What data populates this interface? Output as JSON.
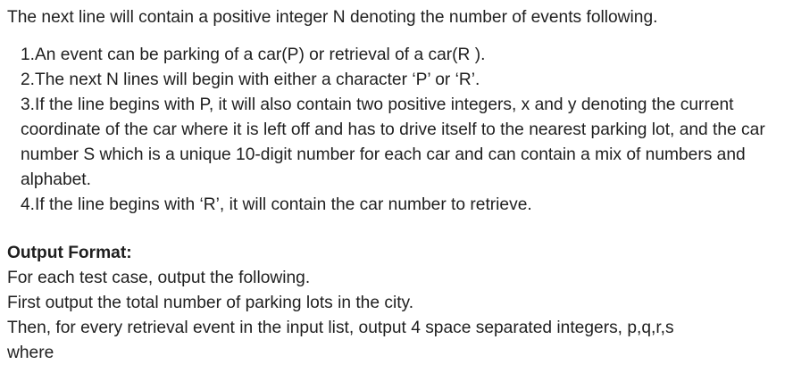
{
  "intro": "The next line will contain a positive integer N denoting the number of events following.",
  "rules": [
    "1.An event can be parking of a car(P) or retrieval of a car(R ).",
    "2.The next N lines will begin with either a character ‘P’ or ‘R’.",
    "3.If the line begins with P, it will also contain two positive integers, x and y denoting the current coordinate of the car where it is left off and has to drive itself to the nearest parking lot, and the car number S which is a unique 10-digit number for each car and can contain a mix of numbers and alphabet.",
    "4.If the line begins with ‘R’, it will contain the car number to retrieve."
  ],
  "output_format": {
    "heading": "Output Format:",
    "lines": [
      "For each test case, output the following.",
      "First output the total number of parking lots in the city.",
      "Then, for every retrieval event in the input list, output 4 space separated integers, p,q,r,s",
      "where"
    ]
  }
}
